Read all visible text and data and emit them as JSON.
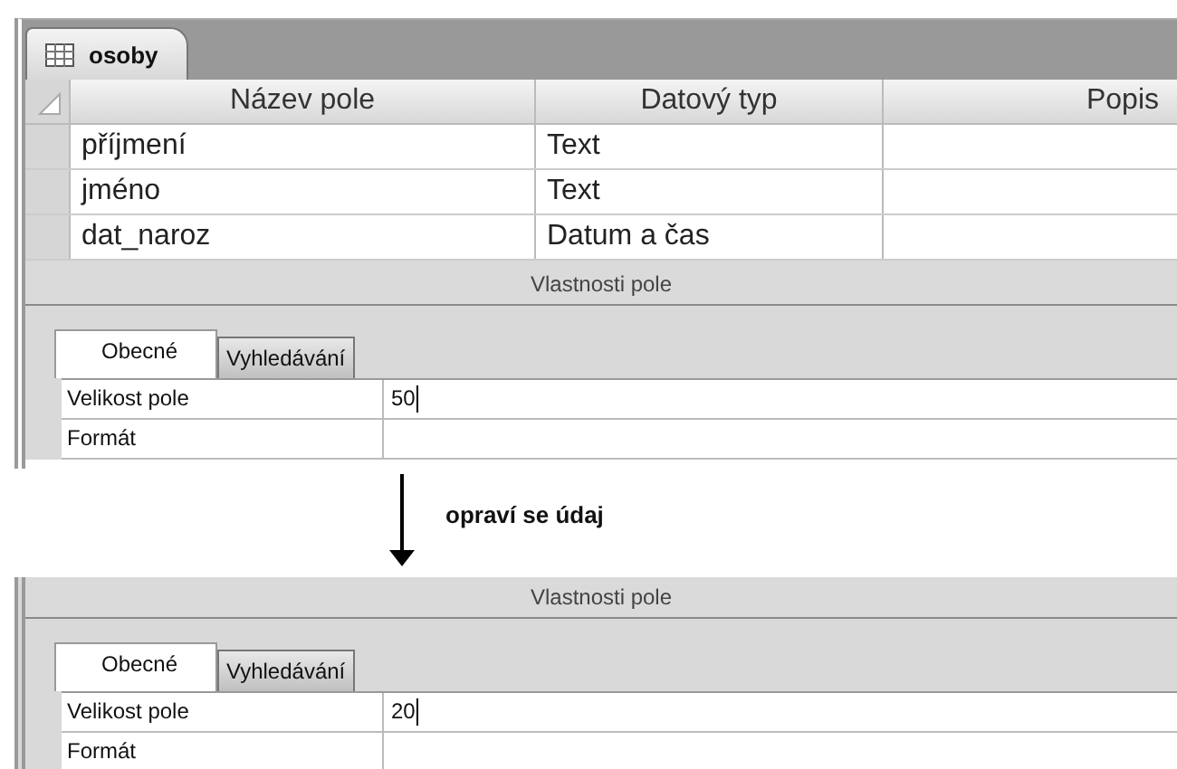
{
  "table_tab": {
    "title": "osoby"
  },
  "grid": {
    "columns": [
      "Název pole",
      "Datový typ",
      "Popis"
    ],
    "rows": [
      {
        "name": "příjmení",
        "type": "Text"
      },
      {
        "name": "jméno",
        "type": "Text"
      },
      {
        "name": "dat_naroz",
        "type": "Datum a čas"
      }
    ]
  },
  "before": {
    "section_title": "Vlastnosti pole",
    "tabs": [
      {
        "label": "Obecné",
        "selected": true
      },
      {
        "label": "Vyhledávání",
        "selected": false
      }
    ],
    "properties": [
      {
        "label": "Velikost pole",
        "value": "50"
      },
      {
        "label": "Formát"
      }
    ]
  },
  "annotation": "opraví se údaj",
  "after": {
    "section_title": "Vlastnosti pole",
    "tabs": [
      {
        "label": "Obecné",
        "selected": true
      },
      {
        "label": "Vyhledávání",
        "selected": false
      }
    ],
    "properties": [
      {
        "label": "Velikost pole",
        "value": "20"
      },
      {
        "label": "Formát"
      }
    ]
  }
}
